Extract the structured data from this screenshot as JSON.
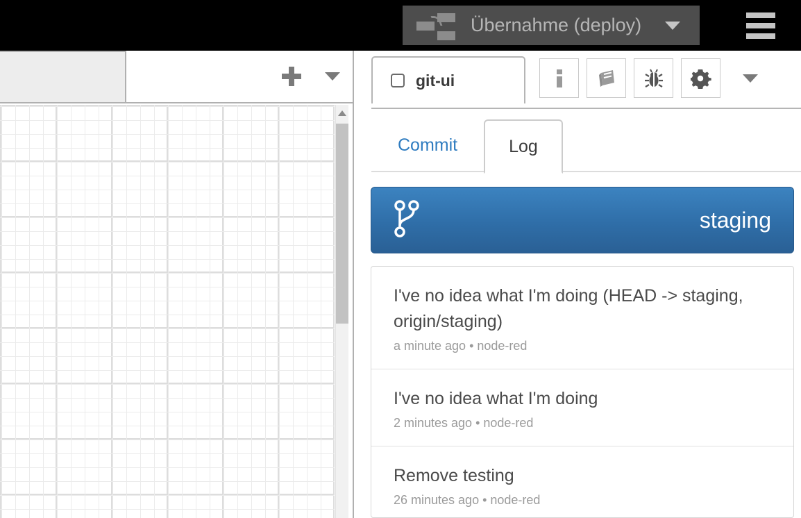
{
  "header": {
    "deploy_label": "Übernahme (deploy)",
    "deploy_icon": "node-flow-icon",
    "deploy_caret_icon": "chevron-down-icon",
    "menu_icon": "hamburger-menu-icon"
  },
  "editor": {
    "flow_tab_label": "",
    "add_tab_icon": "plus-icon",
    "tab_menu_icon": "chevron-down-icon",
    "scroll_up_icon": "caret-up-icon"
  },
  "sidebar": {
    "tab": {
      "label": "git-ui",
      "checkbox_icon": "checkbox-unchecked-icon",
      "checked": false
    },
    "icon_buttons": [
      {
        "name": "info-icon",
        "title": "i"
      },
      {
        "name": "book-icon",
        "title": ""
      },
      {
        "name": "bug-icon",
        "title": ""
      },
      {
        "name": "gear-icon",
        "title": ""
      }
    ],
    "more_icon": "chevron-down-icon",
    "tabs": [
      {
        "label": "Commit",
        "active": false
      },
      {
        "label": "Log",
        "active": true
      }
    ],
    "branch": {
      "name": "staging",
      "icon": "git-branch-icon",
      "color": "#3071a9"
    },
    "commits": [
      {
        "subject": "I've no idea what I'm doing (HEAD -> staging, origin/staging)",
        "meta": "a minute ago • node-red"
      },
      {
        "subject": "I've no idea what I'm doing",
        "meta": "2 minutes ago • node-red"
      },
      {
        "subject": "Remove testing",
        "meta": "26 minutes ago • node-red"
      }
    ]
  },
  "colors": {
    "header_bg": "#000000",
    "deploy_bg": "#4d4d4d",
    "accent_blue": "#2f7cc0",
    "branch_blue": "#3071a9"
  }
}
